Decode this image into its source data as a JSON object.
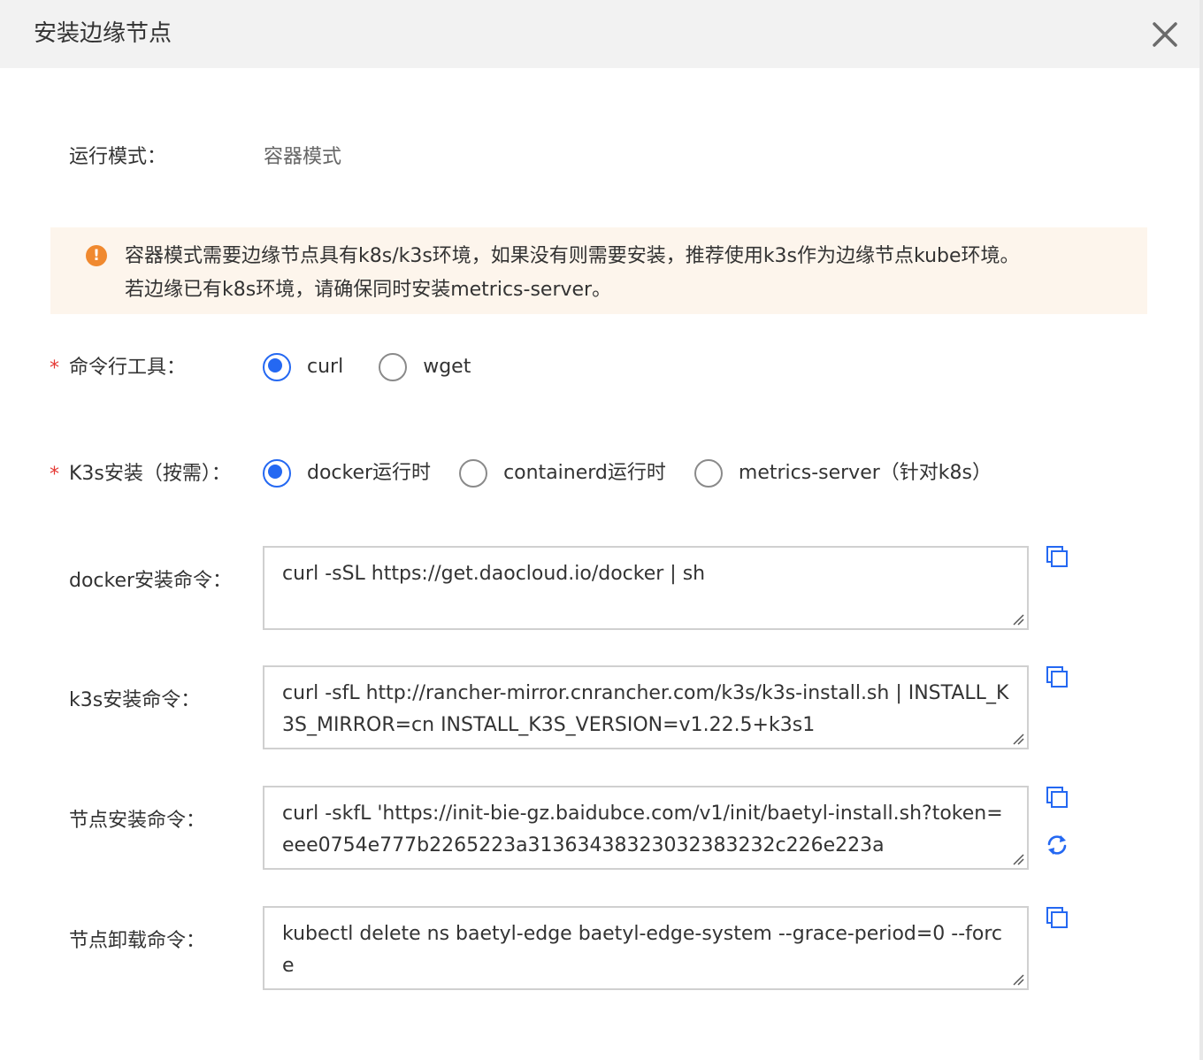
{
  "dialog": {
    "title": "安装边缘节点",
    "close_icon": "close-icon"
  },
  "run_mode": {
    "label": "运行模式：",
    "value": "容器模式"
  },
  "notice": {
    "icon": "warning-icon",
    "icon_glyph": "!",
    "line1": "容器模式需要边缘节点具有k8s/k3s环境，如果没有则需要安装，推荐使用k3s作为边缘节点kube环境。",
    "line2": "若边缘已有k8s环境，请确保同时安装metrics-server。"
  },
  "cli_tool": {
    "required_mark": "*",
    "label": "命令行工具：",
    "options": [
      {
        "label": "curl",
        "checked": true
      },
      {
        "label": "wget",
        "checked": false
      }
    ]
  },
  "k3s_install": {
    "required_mark": "*",
    "label": "K3s安装（按需）：",
    "options": [
      {
        "label": "docker运行时",
        "checked": true
      },
      {
        "label": "containerd运行时",
        "checked": false
      },
      {
        "label": "metrics-server（针对k8s）",
        "checked": false
      }
    ]
  },
  "commands": {
    "docker": {
      "label": "docker安装命令：",
      "value": "curl -sSL https://get.daocloud.io/docker | sh"
    },
    "k3s": {
      "label": "k3s安装命令：",
      "value": "curl -sfL http://rancher-mirror.cnrancher.com/k3s/k3s-install.sh | INSTALL_K3S_MIRROR=cn INSTALL_K3S_VERSION=v1.22.5+k3s1"
    },
    "node_install": {
      "label": "节点安装命令：",
      "value": "curl -skfL 'https://init-bie-gz.baidubce.com/v1/init/baetyl-install.sh?token=eee0754e777b2265223a31363438323032383232c226e223a"
    },
    "node_uninstall": {
      "label": "节点卸载命令：",
      "value": "kubectl delete ns baetyl-edge baetyl-edge-system --grace-period=0 --force"
    }
  },
  "colors": {
    "accent": "#2468f2",
    "warning": "#f0892f",
    "notice_bg": "#fdf5ec",
    "required": "#e53935"
  }
}
